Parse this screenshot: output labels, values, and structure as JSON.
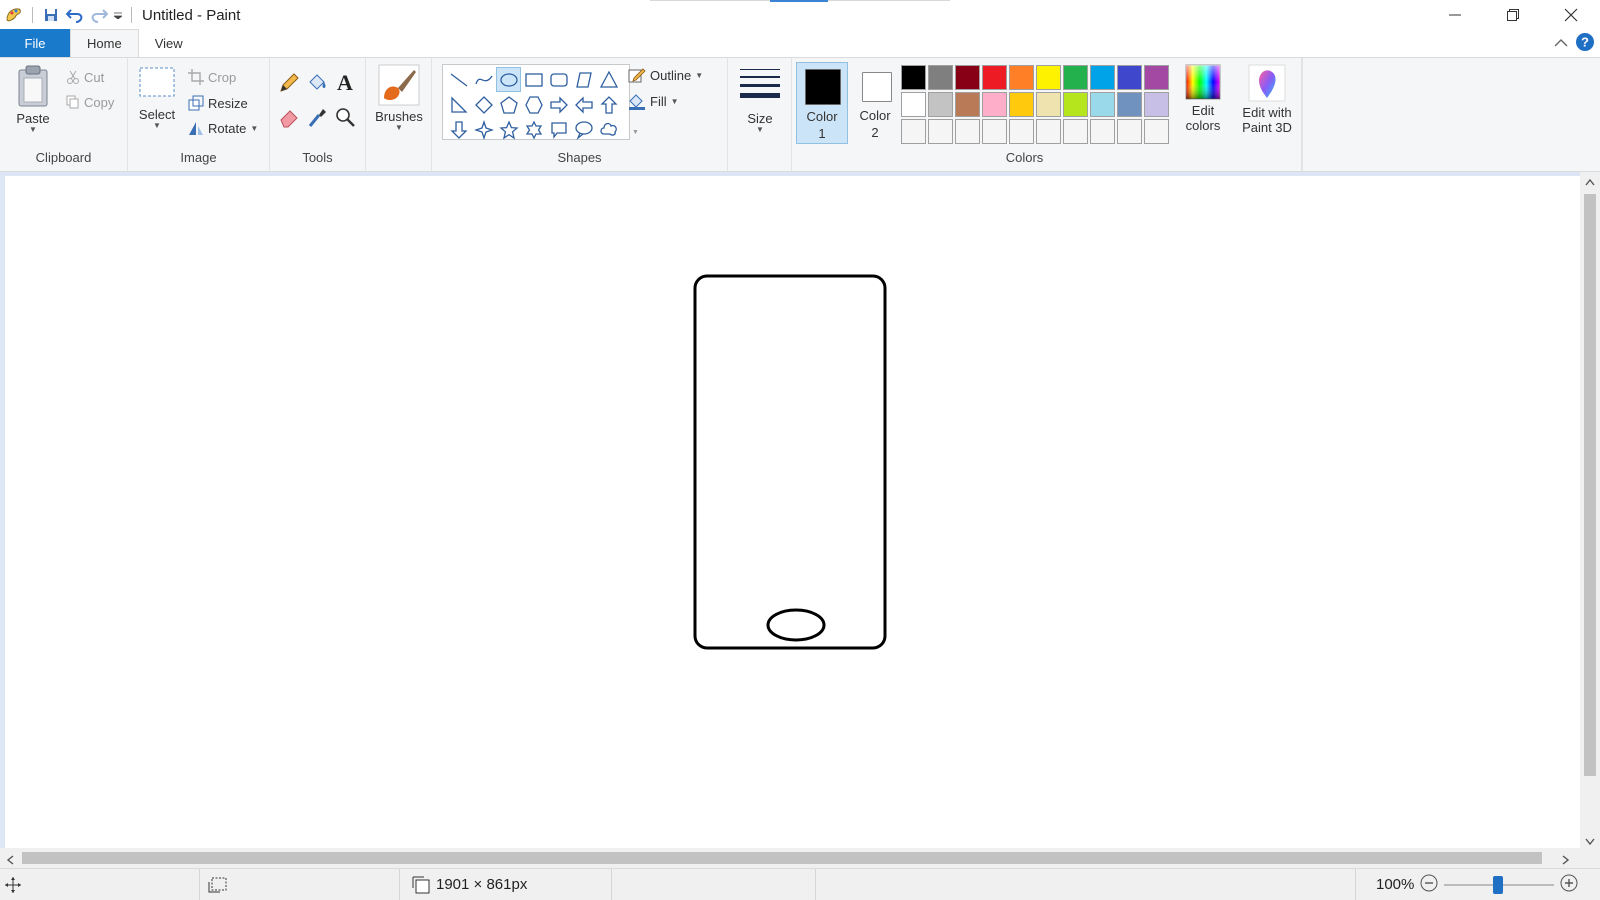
{
  "window": {
    "title": "Untitled - Paint"
  },
  "tabs": [
    {
      "label": "File"
    },
    {
      "label": "Home"
    },
    {
      "label": "View"
    }
  ],
  "ribbon": {
    "clipboard": {
      "group": "Clipboard",
      "paste": "Paste",
      "cut": "Cut",
      "copy": "Copy"
    },
    "image": {
      "group": "Image",
      "select": "Select",
      "crop": "Crop",
      "resize": "Resize",
      "rotate": "Rotate"
    },
    "tools": {
      "group": "Tools"
    },
    "brushes": {
      "label": "Brushes"
    },
    "shapes": {
      "group": "Shapes",
      "outline": "Outline",
      "fill": "Fill"
    },
    "size": {
      "label": "Size"
    },
    "colors": {
      "group": "Colors",
      "color1_line1": "Color",
      "color1_line2": "1",
      "color2_line1": "Color",
      "color2_line2": "2",
      "color1_value": "#000000",
      "color2_value": "#ffffff",
      "edit_line1": "Edit",
      "edit_line2": "colors",
      "paint3d_line1": "Edit with",
      "paint3d_line2": "Paint 3D",
      "palette": [
        "#000000",
        "#7f7f7f",
        "#880015",
        "#ed1c24",
        "#ff7f27",
        "#fff200",
        "#22b14c",
        "#00a2e8",
        "#3f48cc",
        "#a349a4",
        "#ffffff",
        "#c3c3c3",
        "#b97a57",
        "#ffaec9",
        "#ffc90e",
        "#efe4b0",
        "#b5e61d",
        "#99d9ea",
        "#7092be",
        "#c8bfe7",
        "#f5f5f5",
        "#f5f5f5",
        "#f5f5f5",
        "#f5f5f5",
        "#f5f5f5",
        "#f5f5f5",
        "#f5f5f5",
        "#f5f5f5",
        "#f5f5f5",
        "#f5f5f5"
      ]
    }
  },
  "status": {
    "image_size": "1901 × 861px",
    "zoom": "100%"
  }
}
